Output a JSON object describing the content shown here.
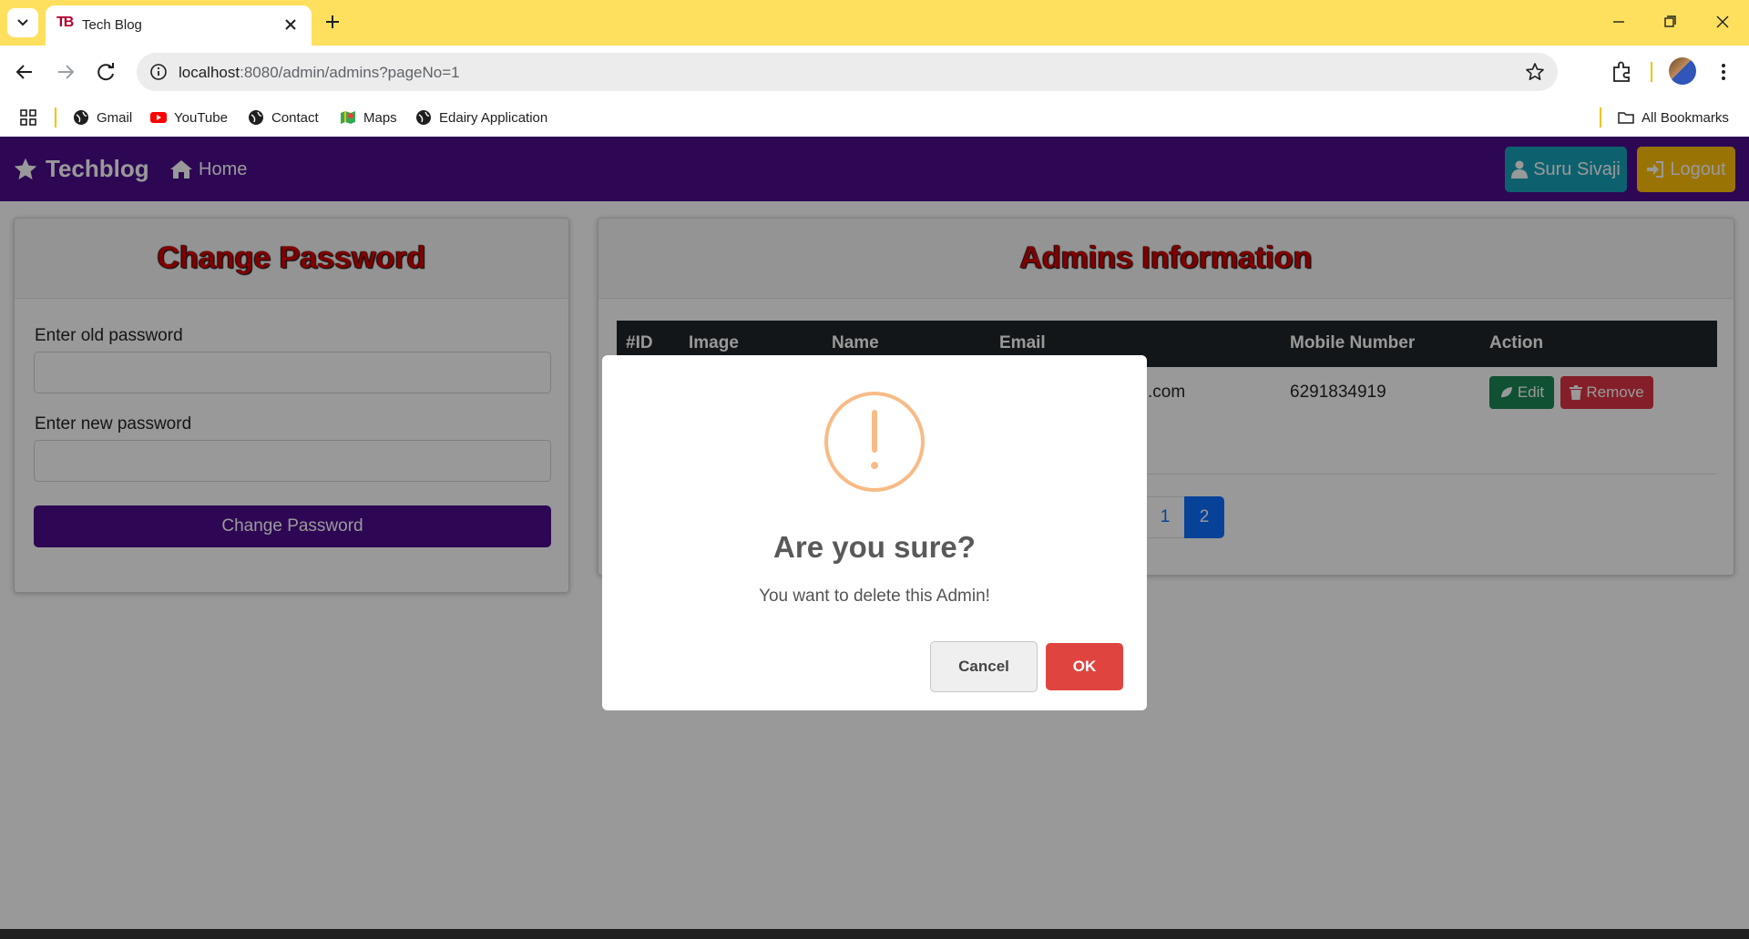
{
  "browser": {
    "tab_favicon": "TB",
    "tab_title": "Tech Blog",
    "url_host": "localhost",
    "url_rest": ":8080/admin/admins?pageNo=1",
    "bookmarks": [
      "Gmail",
      "YouTube",
      "Contact",
      "Maps",
      "Edairy Application"
    ],
    "all_bookmarks": "All Bookmarks"
  },
  "navbar": {
    "brand": "Techblog",
    "home": "Home",
    "user": "Suru Sivaji",
    "logout": "Logout"
  },
  "change_password": {
    "title": "Change Password",
    "old_label": "Enter old password",
    "new_label": "Enter new password",
    "old_value": "",
    "new_value": "",
    "submit": "Change Password"
  },
  "admins": {
    "title": "Admins Information",
    "columns": [
      "#ID",
      "Image",
      "Name",
      "Email",
      "Mobile Number",
      "Action"
    ],
    "rows": [
      {
        "email_visible": "ail.com",
        "mobile": "6291834919",
        "edit": "Edit",
        "remove": "Remove"
      }
    ],
    "pages": [
      "1",
      "2"
    ],
    "active_page": "2"
  },
  "modal": {
    "icon": "warning-icon",
    "title": "Are you sure?",
    "text": "You want to delete this Admin!",
    "cancel": "Cancel",
    "ok": "OK"
  },
  "colors": {
    "navbar": "#4b0d8c",
    "title_red": "#d40000",
    "warning_orange": "#f8bb86",
    "ok_red": "#e0443f",
    "primary_blue": "#0d6efd"
  }
}
